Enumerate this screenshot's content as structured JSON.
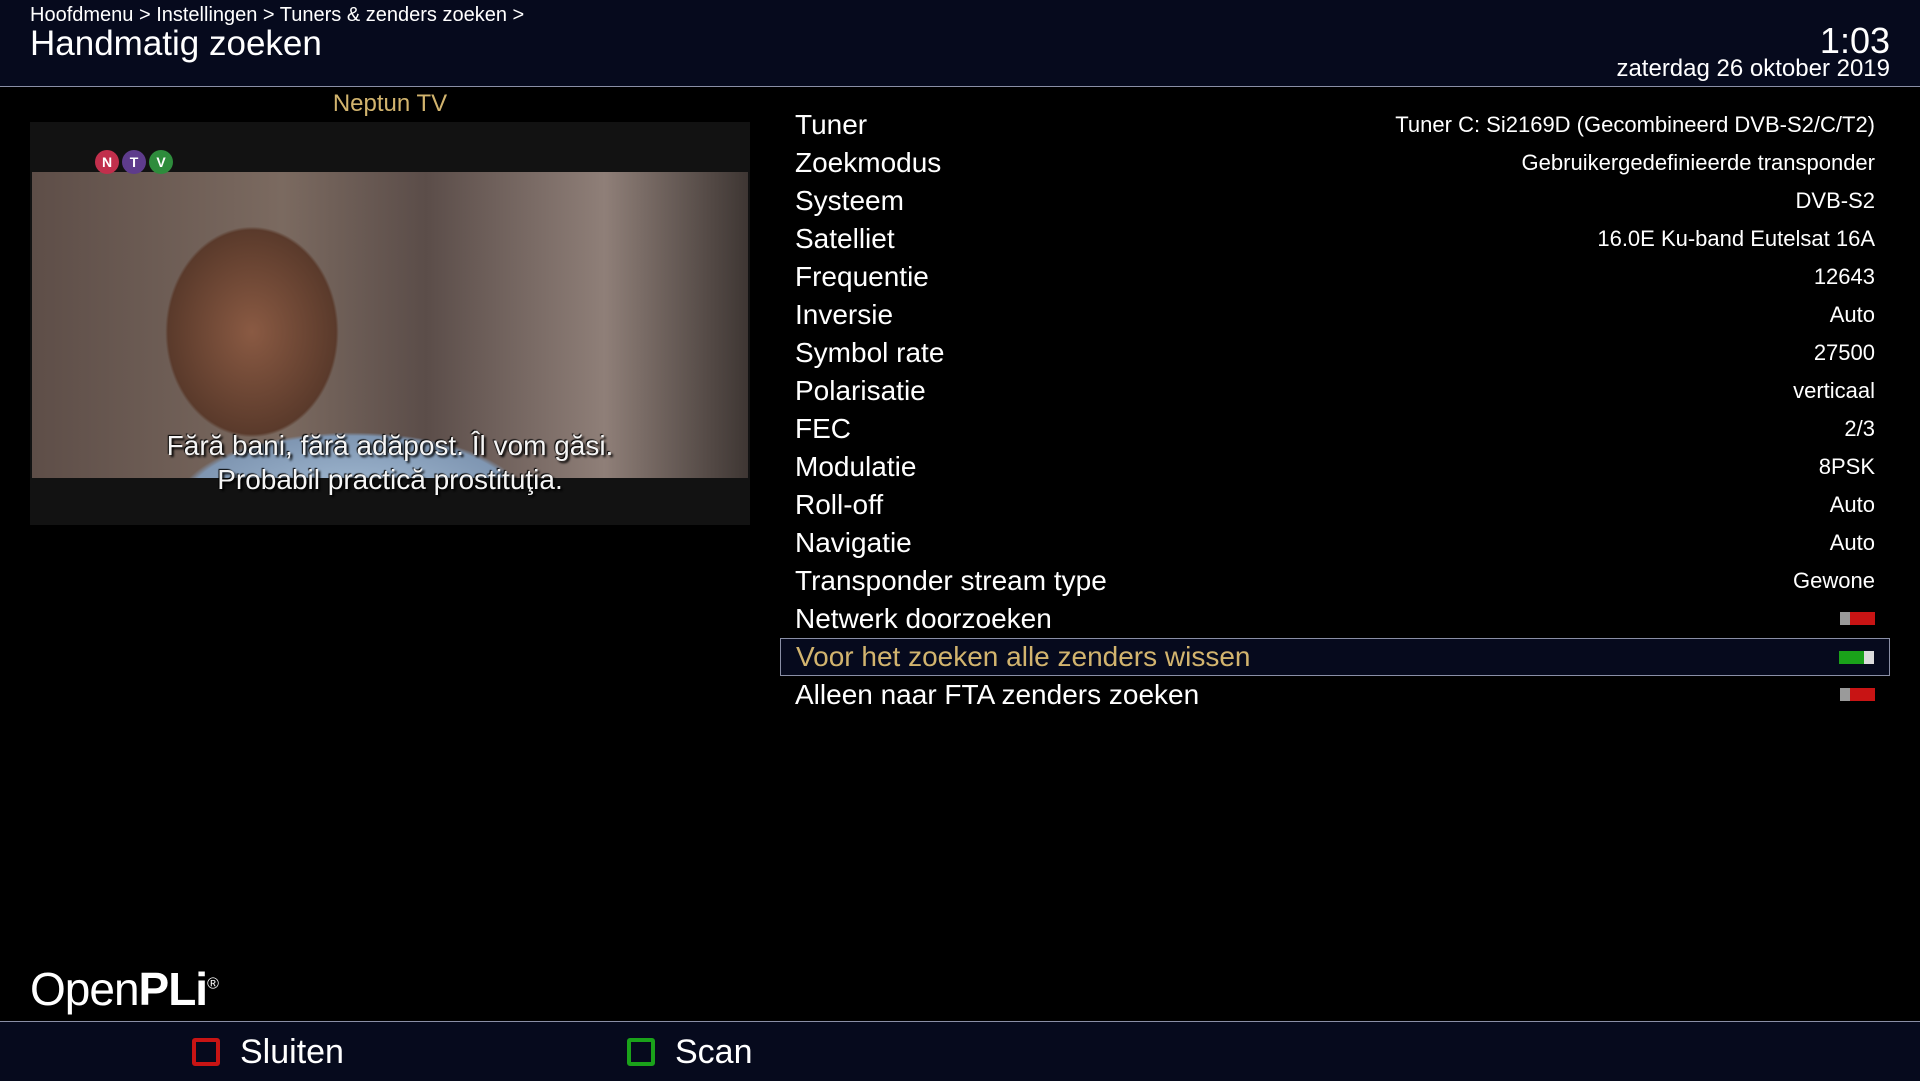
{
  "header": {
    "breadcrumb": "Hoofdmenu > Instellingen > Tuners & zenders zoeken >",
    "title": "Handmatig zoeken",
    "time": "1:03",
    "date": "zaterdag 26 oktober 2019"
  },
  "preview": {
    "channel": "Neptun TV",
    "logo_letters": [
      "N",
      "T",
      "V"
    ],
    "subtitle_line1": "Fără bani, fără adăpost. Îl vom găsi.",
    "subtitle_line2": "Probabil practică prostituţia."
  },
  "settings": [
    {
      "label": "Tuner",
      "value": "Tuner C: Si2169D (Gecombineerd DVB-S2/C/T2)"
    },
    {
      "label": "Zoekmodus",
      "value": "Gebruikergedefinieerde transponder"
    },
    {
      "label": "Systeem",
      "value": "DVB-S2"
    },
    {
      "label": "Satelliet",
      "value": "16.0E Ku-band Eutelsat 16A"
    },
    {
      "label": "Frequentie",
      "value": "12643"
    },
    {
      "label": "Inversie",
      "value": "Auto"
    },
    {
      "label": "Symbol rate",
      "value": "27500"
    },
    {
      "label": "Polarisatie",
      "value": "verticaal"
    },
    {
      "label": "FEC",
      "value": "2/3"
    },
    {
      "label": "Modulatie",
      "value": "8PSK"
    },
    {
      "label": "Roll-off",
      "value": "Auto"
    },
    {
      "label": "Navigatie",
      "value": "Auto"
    },
    {
      "label": "Transponder stream type",
      "value": "Gewone"
    },
    {
      "label": "Netwerk doorzoeken",
      "toggle": false
    },
    {
      "label": "Voor het zoeken alle zenders wissen",
      "toggle": true,
      "selected": true
    },
    {
      "label": "Alleen naar FTA zenders zoeken",
      "toggle": false
    }
  ],
  "brand": {
    "part1": "Open",
    "part2": "PLi",
    "mark": "®"
  },
  "footer": {
    "close_label": "Sluiten",
    "scan_label": "Scan"
  },
  "colors": {
    "highlight_text": "#d2b46e",
    "header_bg": "#060a1d",
    "red_button": "#c81414",
    "green_button": "#1aa21a"
  }
}
